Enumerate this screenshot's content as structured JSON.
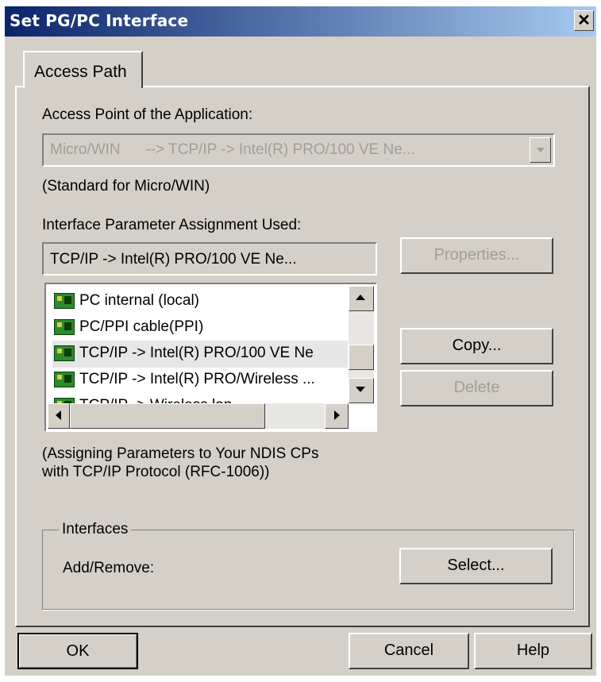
{
  "window": {
    "title": "Set PG/PC Interface",
    "close_glyph": "✕"
  },
  "tabs": [
    {
      "label": "Access Path",
      "active": true
    }
  ],
  "access_point": {
    "label": "Access Point of the Application:",
    "value": "Micro/WIN      --> TCP/IP -> Intel(R) PRO/100 VE Ne...",
    "note": "(Standard for Micro/WIN)",
    "enabled": false
  },
  "interface_param": {
    "label": "Interface Parameter Assignment Used:",
    "value": "TCP/IP -> Intel(R) PRO/100 VE Ne..."
  },
  "interface_list": {
    "items": [
      {
        "label": "PC internal (local)",
        "icon": "network-card-icon"
      },
      {
        "label": "PC/PPI cable(PPI)",
        "icon": "network-card-icon"
      },
      {
        "label": "TCP/IP -> Intel(R) PRO/100 VE Ne",
        "icon": "network-card-icon",
        "selected": true
      },
      {
        "label": "TCP/IP -> Intel(R) PRO/Wireless ...",
        "icon": "network-card-icon"
      },
      {
        "label": "TCP/IP -> Wireless lan",
        "icon": "network-card-icon"
      }
    ]
  },
  "buttons": {
    "properties": "Properties...",
    "copy": "Copy...",
    "delete": "Delete",
    "select": "Select...",
    "ok": "OK",
    "cancel": "Cancel",
    "help": "Help"
  },
  "description": {
    "line1": "(Assigning Parameters to Your NDIS CPs",
    "line2": "with TCP/IP Protocol (RFC-1006))"
  },
  "interfaces_group": {
    "title": "Interfaces",
    "add_remove_label": "Add/Remove:"
  },
  "colors": {
    "dialog_bg": "#d4d0c8",
    "title_gradient_start": "#0a246a",
    "title_gradient_end": "#a6caf0",
    "disabled_text": "#a19e98"
  }
}
